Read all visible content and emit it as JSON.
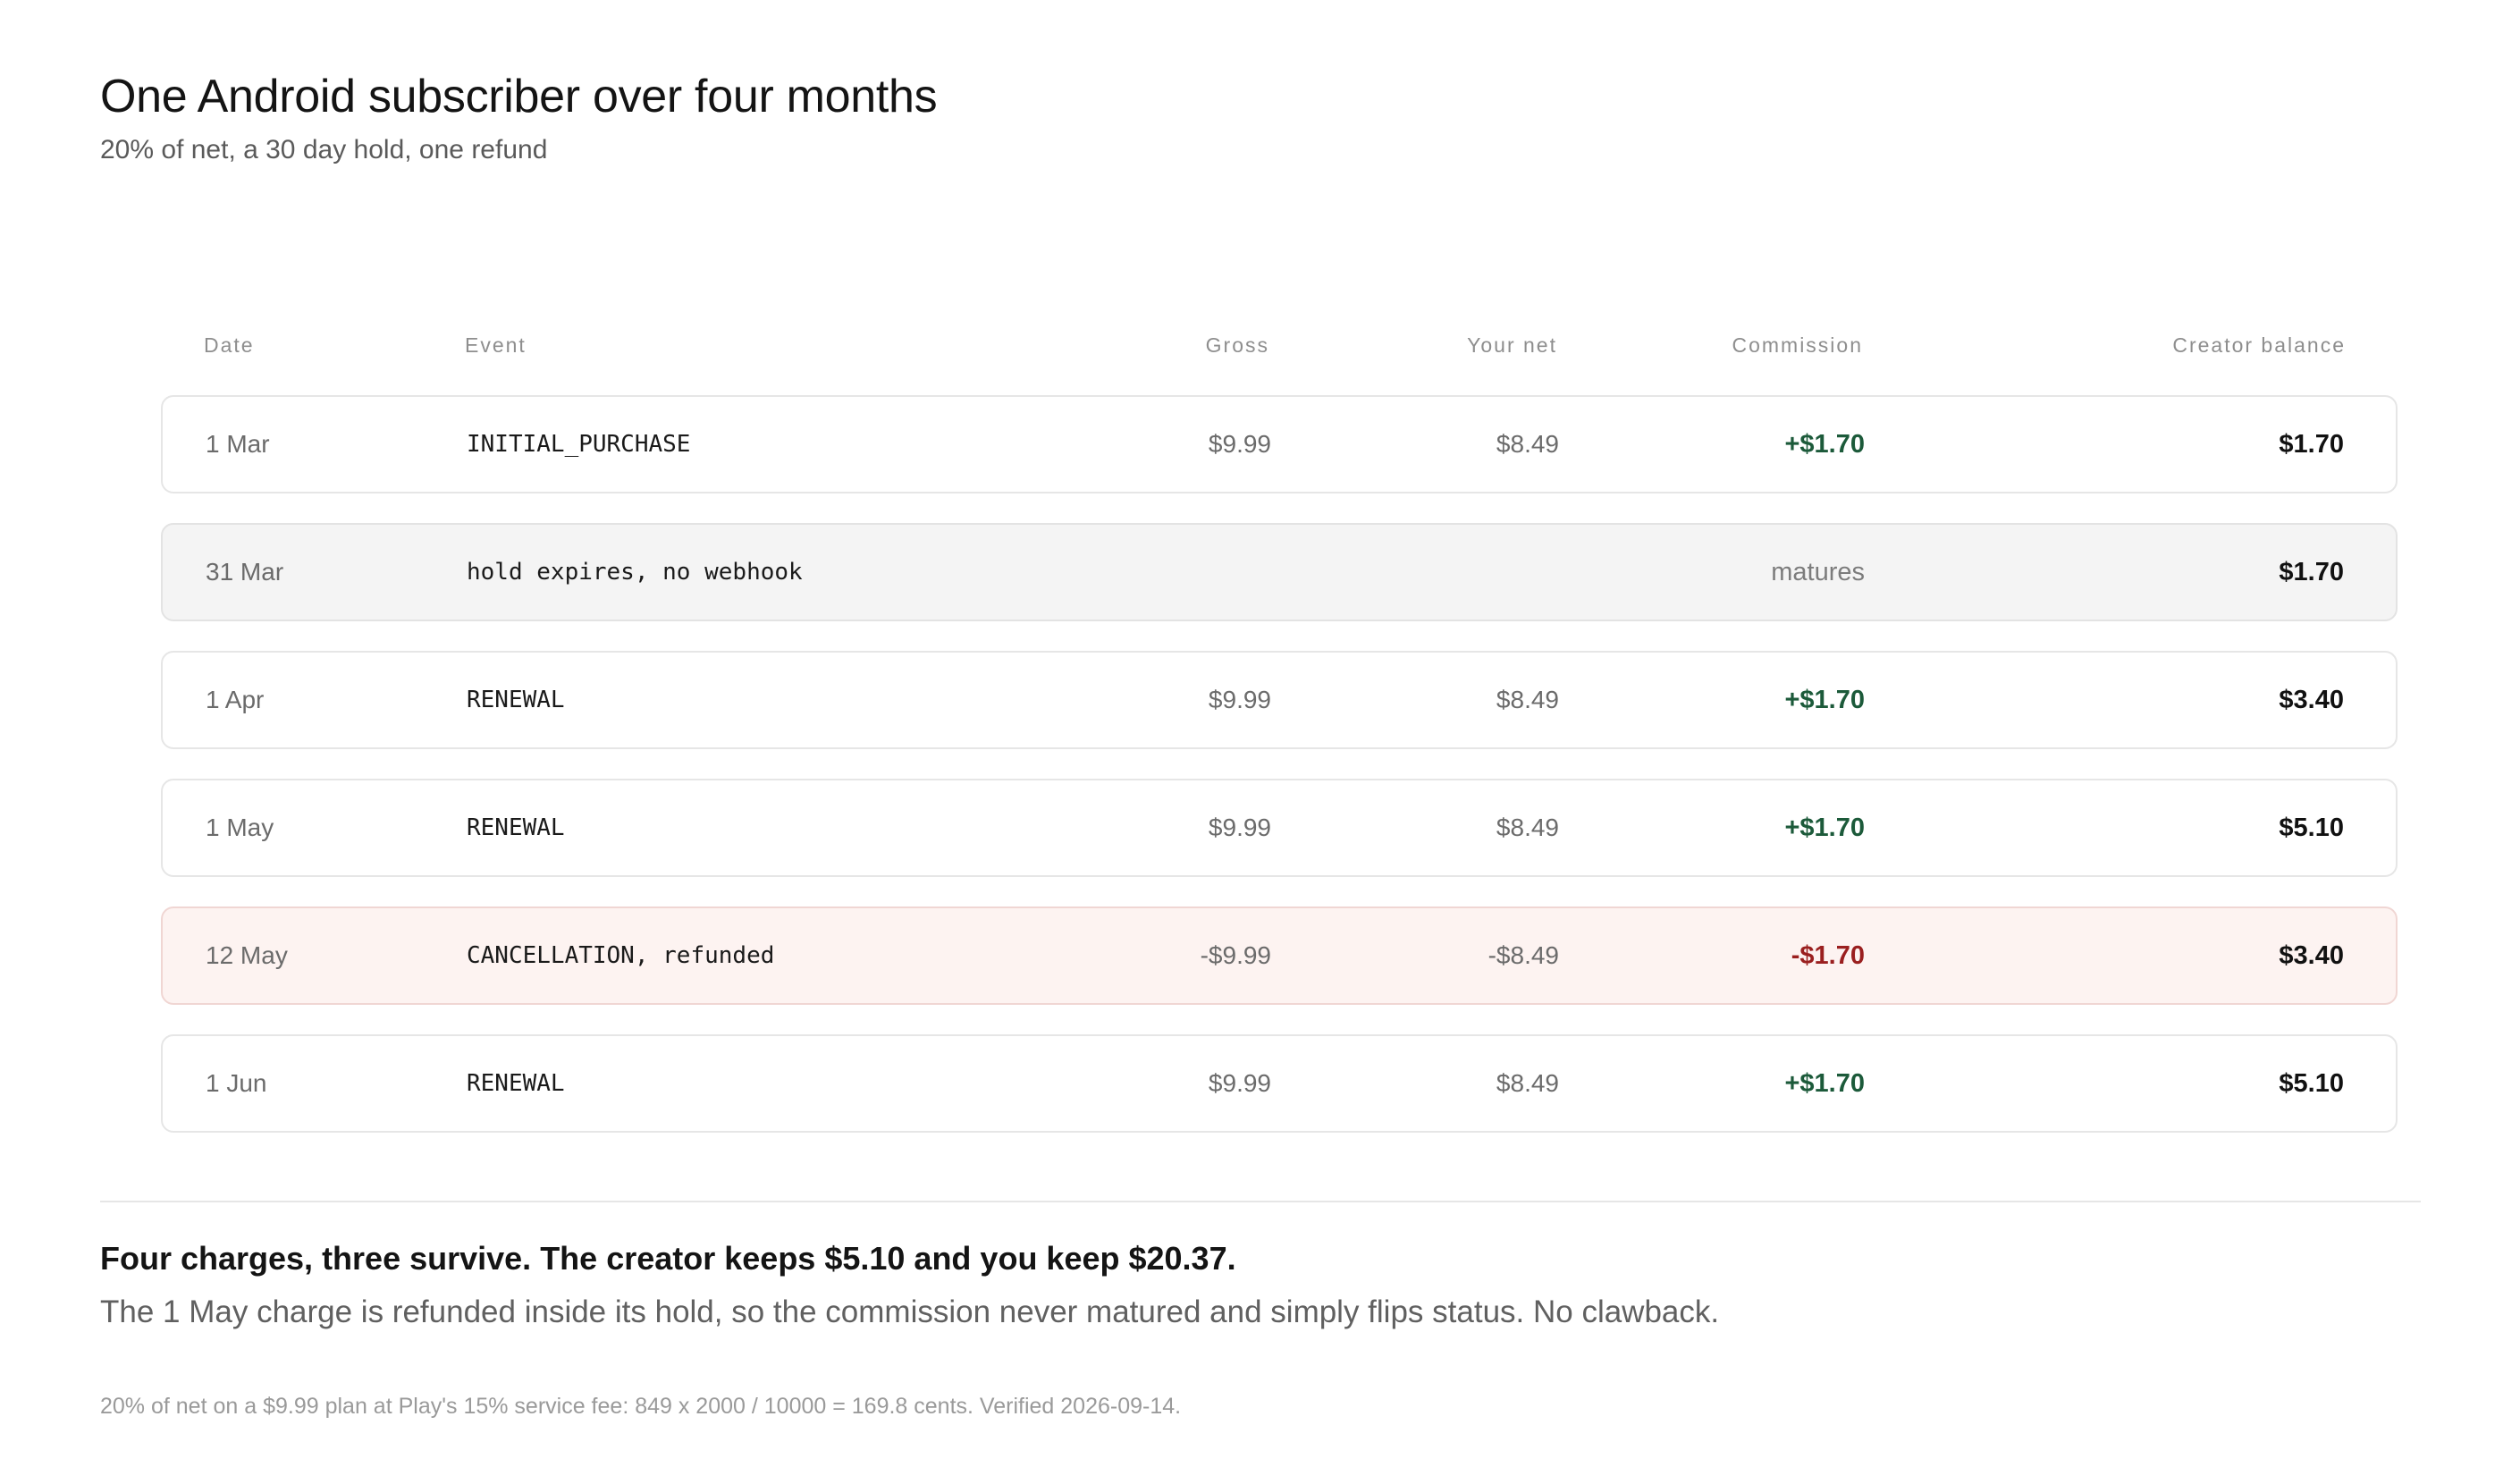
{
  "header": {
    "title": "One Android subscriber over four months",
    "subtitle": "20% of net, a 30 day hold, one refund"
  },
  "table": {
    "columns": [
      "Date",
      "Event",
      "Gross",
      "Your net",
      "Commission",
      "Creator balance"
    ],
    "rows": [
      {
        "date": "1 Mar",
        "event": "INITIAL_PURCHASE",
        "gross": "$9.99",
        "net": "$8.49",
        "commission": "+$1.70",
        "balance": "$1.70"
      },
      {
        "date": "31 Mar",
        "event": "hold expires, no webhook",
        "gross": "",
        "net": "",
        "commission": "matures",
        "balance": "$1.70"
      },
      {
        "date": "1 Apr",
        "event": "RENEWAL",
        "gross": "$9.99",
        "net": "$8.49",
        "commission": "+$1.70",
        "balance": "$3.40"
      },
      {
        "date": "1 May",
        "event": "RENEWAL",
        "gross": "$9.99",
        "net": "$8.49",
        "commission": "+$1.70",
        "balance": "$5.10"
      },
      {
        "date": "12 May",
        "event": "CANCELLATION, refunded",
        "gross": "-$9.99",
        "net": "-$8.49",
        "commission": "-$1.70",
        "balance": "$3.40"
      },
      {
        "date": "1 Jun",
        "event": "RENEWAL",
        "gross": "$9.99",
        "net": "$8.49",
        "commission": "+$1.70",
        "balance": "$5.10"
      }
    ]
  },
  "summary": {
    "headline": "Four charges, three survive. The creator keeps $5.10 and you keep $20.37.",
    "explanation": "The 1 May charge is refunded inside its hold, so the commission never matured and simply flips status. No clawback."
  },
  "footnote": "20% of net on a $9.99 plan at Play's 15% service fee: 849 x 2000 / 10000 = 169.8 cents. Verified 2026-09-14.",
  "colors": {
    "positive": "#1c5a3a",
    "negative": "#9a1f1f",
    "refund_row_bg": "#fdf3f1",
    "muted_row_bg": "#f4f4f4"
  }
}
